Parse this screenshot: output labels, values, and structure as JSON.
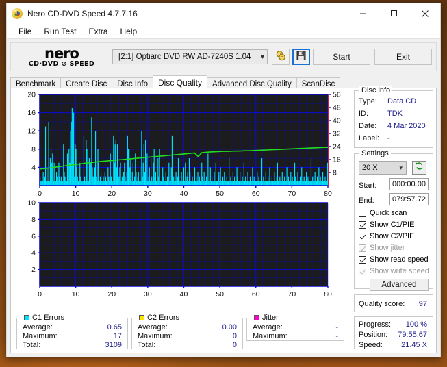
{
  "window": {
    "title": "Nero CD-DVD Speed 4.7.7.16",
    "app_icon": "nero-disc-icon",
    "minimize": "minimize-icon",
    "maximize": "maximize-icon",
    "close": "close-icon"
  },
  "menu": {
    "items": [
      "File",
      "Run Test",
      "Extra",
      "Help"
    ]
  },
  "toolbar": {
    "logo_line1": "nero",
    "logo_line2": "CD·DVD ⊘ SPEED",
    "drive": "[2:1]   Optiarc DVD RW AD-7240S 1.04",
    "eject_icon": "eject-disc-icon",
    "save_icon": "save-floppy-icon",
    "start_label": "Start",
    "exit_label": "Exit"
  },
  "tabs": {
    "items": [
      "Benchmark",
      "Create Disc",
      "Disc Info",
      "Disc Quality",
      "Advanced Disc Quality",
      "ScanDisc"
    ],
    "active": "Disc Quality"
  },
  "disc_info": {
    "title": "Disc info",
    "rows": [
      {
        "label": "Type:",
        "value": "Data CD"
      },
      {
        "label": "ID:",
        "value": "TDK"
      },
      {
        "label": "Date:",
        "value": "4 Mar 2020"
      },
      {
        "label": "Label:",
        "value": "-"
      }
    ]
  },
  "settings": {
    "title": "Settings",
    "speed": "20 X",
    "refresh_icon": "refresh-arrows-icon",
    "start_label": "Start:",
    "start_value": "000:00.00",
    "end_label": "End:",
    "end_value": "079:57.72",
    "checkboxes": [
      {
        "label": "Quick scan",
        "checked": false,
        "enabled": true
      },
      {
        "label": "Show C1/PIE",
        "checked": true,
        "enabled": true
      },
      {
        "label": "Show C2/PIF",
        "checked": true,
        "enabled": true
      },
      {
        "label": "Show jitter",
        "checked": true,
        "enabled": false
      },
      {
        "label": "Show read speed",
        "checked": true,
        "enabled": true
      },
      {
        "label": "Show write speed",
        "checked": true,
        "enabled": false
      }
    ],
    "advanced_label": "Advanced"
  },
  "quality": {
    "label": "Quality score:",
    "value": "97"
  },
  "progress": {
    "rows": [
      {
        "label": "Progress:",
        "value": "100 %"
      },
      {
        "label": "Position:",
        "value": "79:55.67"
      },
      {
        "label": "Speed:",
        "value": "21.45 X"
      }
    ]
  },
  "stats": [
    {
      "title": "C1 Errors",
      "color": "#00e5ff",
      "rows": [
        {
          "label": "Average:",
          "value": "0.65"
        },
        {
          "label": "Maximum:",
          "value": "17"
        },
        {
          "label": "Total:",
          "value": "3109"
        }
      ]
    },
    {
      "title": "C2 Errors",
      "color": "#ffe600",
      "rows": [
        {
          "label": "Average:",
          "value": "0.00"
        },
        {
          "label": "Maximum:",
          "value": "0"
        },
        {
          "label": "Total:",
          "value": "0"
        }
      ]
    },
    {
      "title": "Jitter",
      "color": "#ff00d0",
      "rows": [
        {
          "label": "Average:",
          "value": "-"
        },
        {
          "label": "Maximum:",
          "value": "-"
        }
      ]
    }
  ],
  "chart_data": [
    {
      "type": "bar",
      "name": "c1-errors-chart",
      "title": "",
      "xlabel": "",
      "ylabel": "",
      "x": [
        0,
        80
      ],
      "xlim": [
        0,
        80
      ],
      "xticks": [
        0,
        10,
        20,
        30,
        40,
        50,
        60,
        70,
        80
      ],
      "ylim": [
        0,
        20
      ],
      "yticks": [
        4,
        8,
        12,
        16,
        20
      ],
      "grid": true,
      "bg": "#1c1c1c",
      "grid_color": "#0a0ad8",
      "series": [
        {
          "name": "C1 errors",
          "type": "bar",
          "color": "#00e5ff",
          "axis": "left",
          "values": [
            2,
            1,
            1,
            1,
            3,
            1,
            2,
            13,
            1,
            4,
            1,
            14,
            1,
            6,
            8,
            5,
            7,
            1,
            5,
            1,
            1,
            3,
            2,
            1,
            5,
            2,
            1,
            2,
            1,
            1,
            9,
            3,
            2,
            1,
            1,
            7,
            1,
            8,
            5,
            12,
            14,
            17,
            14,
            16,
            2,
            9,
            8,
            4,
            2,
            1,
            3,
            5,
            2,
            1,
            1,
            1,
            11,
            2,
            1,
            10,
            8,
            1,
            1,
            6,
            3,
            5,
            15,
            4,
            2,
            2,
            4,
            12,
            2,
            1,
            8,
            5,
            1,
            2,
            3,
            1,
            1,
            2,
            1,
            3,
            2,
            1,
            1,
            4,
            2,
            1,
            7,
            2,
            1,
            1,
            11,
            5,
            9,
            10,
            4,
            9,
            2,
            2,
            4,
            5,
            1,
            2,
            1,
            3,
            5,
            2,
            1,
            3,
            11,
            8,
            8,
            4,
            6,
            1,
            3,
            5,
            1,
            2,
            7,
            3,
            1,
            2,
            3,
            1,
            4,
            1,
            12,
            2,
            5,
            9,
            3,
            10,
            1,
            7,
            1,
            2,
            4,
            1,
            6,
            2,
            1,
            5,
            8,
            2,
            3,
            1,
            1,
            6,
            2,
            8,
            1,
            1,
            2,
            4,
            2,
            1,
            1,
            3,
            1,
            2,
            2,
            5,
            1,
            1,
            4,
            11,
            1,
            2,
            1,
            1,
            3,
            1,
            2,
            6,
            2,
            1,
            1,
            3,
            1,
            2,
            4,
            1,
            5,
            1,
            2,
            3,
            1,
            6,
            3,
            1,
            1,
            2,
            1,
            1,
            4,
            1,
            2,
            1,
            3,
            1,
            2,
            1,
            1,
            5,
            2,
            1,
            3,
            1,
            1,
            2,
            1,
            7,
            1,
            1,
            4,
            1,
            2,
            1,
            1,
            3,
            1,
            5,
            1,
            1,
            2,
            3,
            1,
            4,
            1,
            1,
            2,
            1,
            3,
            1,
            1,
            2,
            1,
            1,
            6,
            1,
            2,
            1,
            1,
            3,
            1,
            2,
            1,
            1,
            4,
            2,
            1,
            1,
            3,
            1,
            1,
            2,
            1,
            5,
            1,
            2,
            1,
            1,
            3,
            1,
            1,
            2,
            1,
            1,
            4,
            1,
            2,
            1,
            1,
            1,
            3,
            1,
            2,
            1,
            1,
            1,
            6,
            1,
            2,
            1,
            1,
            3,
            1,
            1,
            2,
            1,
            4,
            1,
            1,
            2,
            1,
            1,
            3,
            1,
            1,
            2,
            5,
            1,
            1,
            2,
            1,
            1,
            3,
            1,
            1,
            2,
            1,
            1,
            4,
            1,
            2,
            1,
            1,
            3,
            1,
            2,
            1,
            1,
            5,
            2,
            1,
            1,
            3,
            1,
            1,
            2,
            1,
            4,
            1,
            1,
            2,
            1,
            1,
            3,
            1,
            2,
            1,
            1,
            1,
            6,
            1,
            2,
            1,
            1,
            3,
            1,
            1,
            2,
            1,
            4,
            1,
            2,
            1,
            1,
            3,
            1,
            1,
            2,
            1,
            1,
            5
          ],
          "note": "Samples span 0-80 min; peak 17"
        },
        {
          "name": "Read speed",
          "type": "line",
          "color": "#22dd22",
          "axis": "right",
          "values": [
            10.2,
            10.4,
            10.6,
            10.9,
            11.2,
            11.5,
            11.8,
            12.1,
            12.4,
            12.7,
            13.0,
            13.2,
            13.5,
            13.8,
            14.1,
            14.3,
            14.6,
            14.8,
            15.0,
            15.2,
            15.4,
            15.6,
            15.8,
            16.0,
            16.2,
            16.4,
            16.6,
            16.8,
            17.0,
            17.2,
            17.4,
            17.6,
            17.8,
            18.0,
            18.2,
            18.4,
            18.6,
            18.8,
            19.0,
            19.2,
            19.4,
            19.6,
            19.8,
            20.0,
            17.8,
            20.2,
            20.4,
            20.6,
            20.7,
            20.8,
            20.9,
            21.0,
            21.0,
            21.1,
            21.2,
            21.2,
            21.3,
            21.4,
            21.4,
            21.5,
            21.6,
            21.7,
            21.8,
            21.9,
            22.0,
            22.1,
            22.2,
            22.3,
            22.4,
            22.5,
            22.6,
            22.7,
            22.8,
            22.9,
            23.0,
            23.1,
            23.2,
            23.3,
            23.4,
            23.5,
            23.5
          ],
          "note": "Green read-speed curve, right axis, 0-56 X"
        }
      ],
      "right_axis": {
        "label": "",
        "ylim": [
          0,
          56
        ],
        "yticks": [
          8,
          16,
          24,
          32,
          40,
          48,
          56
        ]
      }
    },
    {
      "type": "bar",
      "name": "c2-errors-chart",
      "title": "",
      "xlabel": "",
      "ylabel": "",
      "xlim": [
        0,
        80
      ],
      "xticks": [
        0,
        10,
        20,
        30,
        40,
        50,
        60,
        70,
        80
      ],
      "ylim": [
        0,
        10
      ],
      "yticks": [
        2,
        4,
        6,
        8,
        10
      ],
      "grid": true,
      "bg": "#1c1c1c",
      "grid_color": "#0a0ad8",
      "series": [
        {
          "name": "C2 errors",
          "type": "bar",
          "color": "#ffe600",
          "values": [],
          "note": "No C2 errors recorded"
        }
      ]
    }
  ]
}
